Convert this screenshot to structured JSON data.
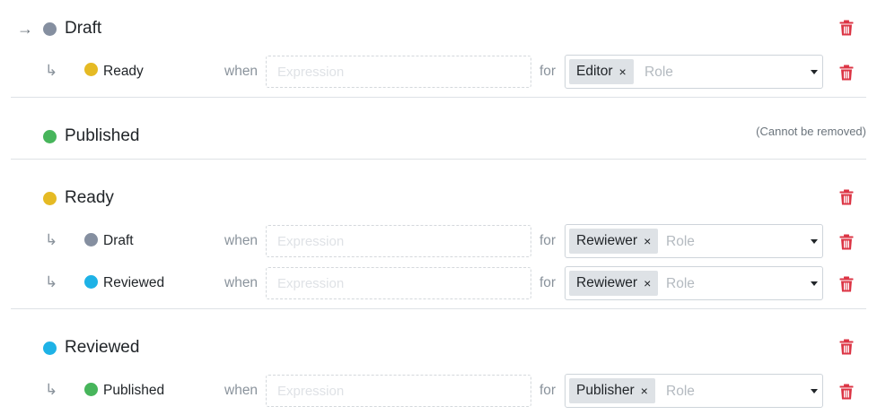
{
  "colors": {
    "draft": "#858fa0",
    "ready": "#e5ba24",
    "published": "#47b55b",
    "reviewed": "#1eb2e6",
    "danger": "#dc3545"
  },
  "labels": {
    "when": "when",
    "for": "for",
    "expression_placeholder": "Expression",
    "role_placeholder": "Role",
    "chip_remove": "×",
    "initial_arrow": "→",
    "transition_arrow": "↳"
  },
  "states": [
    {
      "name": "Draft",
      "color": "#858fa0",
      "initial": true,
      "removable": true,
      "transitions": [
        {
          "target": "Ready",
          "color": "#e5ba24",
          "expression": "",
          "roles": [
            "Editor"
          ]
        }
      ]
    },
    {
      "name": "Published",
      "color": "#47b55b",
      "initial": false,
      "removable": false,
      "note": "(Cannot be removed)",
      "transitions": []
    },
    {
      "name": "Ready",
      "color": "#e5ba24",
      "initial": false,
      "removable": true,
      "transitions": [
        {
          "target": "Draft",
          "color": "#858fa0",
          "expression": "",
          "roles": [
            "Rewiewer"
          ]
        },
        {
          "target": "Reviewed",
          "color": "#1eb2e6",
          "expression": "",
          "roles": [
            "Rewiewer"
          ]
        }
      ]
    },
    {
      "name": "Reviewed",
      "color": "#1eb2e6",
      "initial": false,
      "removable": true,
      "transitions": [
        {
          "target": "Published",
          "color": "#47b55b",
          "expression": "",
          "roles": [
            "Publisher"
          ]
        }
      ]
    }
  ]
}
